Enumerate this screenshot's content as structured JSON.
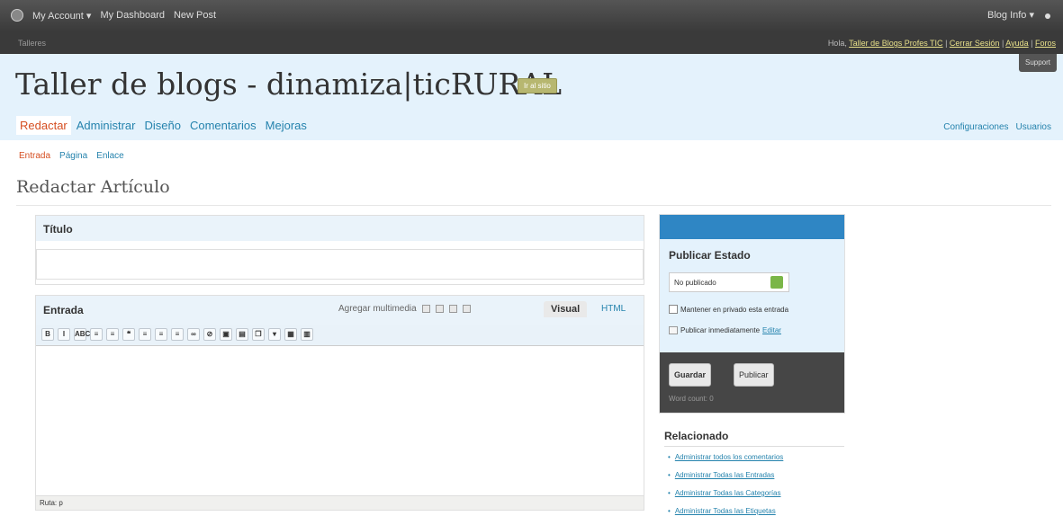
{
  "adminbar": {
    "items": [
      "My Account ▾",
      "My Dashboard",
      "New Post"
    ],
    "blog_info": "Blog Info ▾"
  },
  "userbar": {
    "site": "Talleres",
    "greeting": "Hola, ",
    "user_link": "Taller de Blogs Profes TIC",
    "logout": "Cerrar Sesión",
    "help": "Ayuda",
    "forums": "Foros",
    "support": "Support"
  },
  "header": {
    "title": "Taller de blogs - dinamiza|ticRURAL",
    "view_site": "Ir al sitio"
  },
  "main_nav": [
    "Redactar",
    "Administrar",
    "Diseño",
    "Comentarios",
    "Mejoras"
  ],
  "right_nav": [
    "Configuraciones",
    "Usuarios"
  ],
  "sub_nav": [
    "Entrada",
    "Página",
    "Enlace"
  ],
  "page_title": "Redactar Artículo",
  "title_box": {
    "label": "Título",
    "value": ""
  },
  "editor": {
    "label": "Entrada",
    "add_media": "Agregar multimedia",
    "tab_visual": "Visual",
    "tab_html": "HTML",
    "path": "Ruta: p",
    "toolbar": [
      "B",
      "I",
      "ABC",
      "≡",
      "≡",
      "❝",
      "≡",
      "≡",
      "≡",
      "∞",
      "⊘",
      "▣",
      "▤",
      "❐",
      "▾",
      "▦",
      "▥"
    ]
  },
  "publish": {
    "title": "Publicar Estado",
    "status": "No publicado",
    "private_label": "Mantener en privado esta entrada",
    "publish_now": "Publicar inmediatamente",
    "edit_link": "Editar",
    "save": "Guardar",
    "publish": "Publicar",
    "word_count": "Word count: 0"
  },
  "related": {
    "title": "Relacionado",
    "items": [
      "Administrar todos los comentarios",
      "Administrar Todas las Entradas",
      "Administrar Todas las Categorías",
      "Administrar Todas las Etiquetas"
    ]
  },
  "colors": {
    "header_bg": "#e4f2fc",
    "admin_bar": "#464646",
    "link": "#2583ad",
    "current": "#d54e21",
    "publish_top": "#2f86c4"
  }
}
